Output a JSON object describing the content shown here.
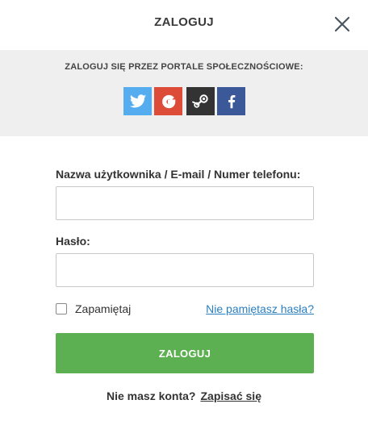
{
  "header": {
    "title": "ZALOGUJ",
    "close_icon": "close-icon"
  },
  "social": {
    "label": "ZALOGUJ SIĘ PRZEZ PORTALE SPOŁECZNOŚCIOWE:",
    "providers": [
      {
        "name": "twitter",
        "icon": "twitter-icon",
        "color": "#55acee"
      },
      {
        "name": "google",
        "icon": "google-icon",
        "color": "#dd4b39"
      },
      {
        "name": "steam",
        "icon": "steam-icon",
        "color": "#333333"
      },
      {
        "name": "facebook",
        "icon": "facebook-icon",
        "color": "#3b5998"
      }
    ]
  },
  "form": {
    "username_label": "Nazwa użytkownika / E-mail / Numer telefonu:",
    "username_value": "",
    "password_label": "Hasło:",
    "password_value": "",
    "remember_label": "Zapamiętaj",
    "remember_checked": false,
    "forgot_link": "Nie pamiętasz hasła?",
    "submit_label": "ZALOGUJ",
    "submit_color": "#5cb051"
  },
  "footer": {
    "no_account_text": "Nie masz konta?",
    "signup_link": "Zapisać się"
  }
}
